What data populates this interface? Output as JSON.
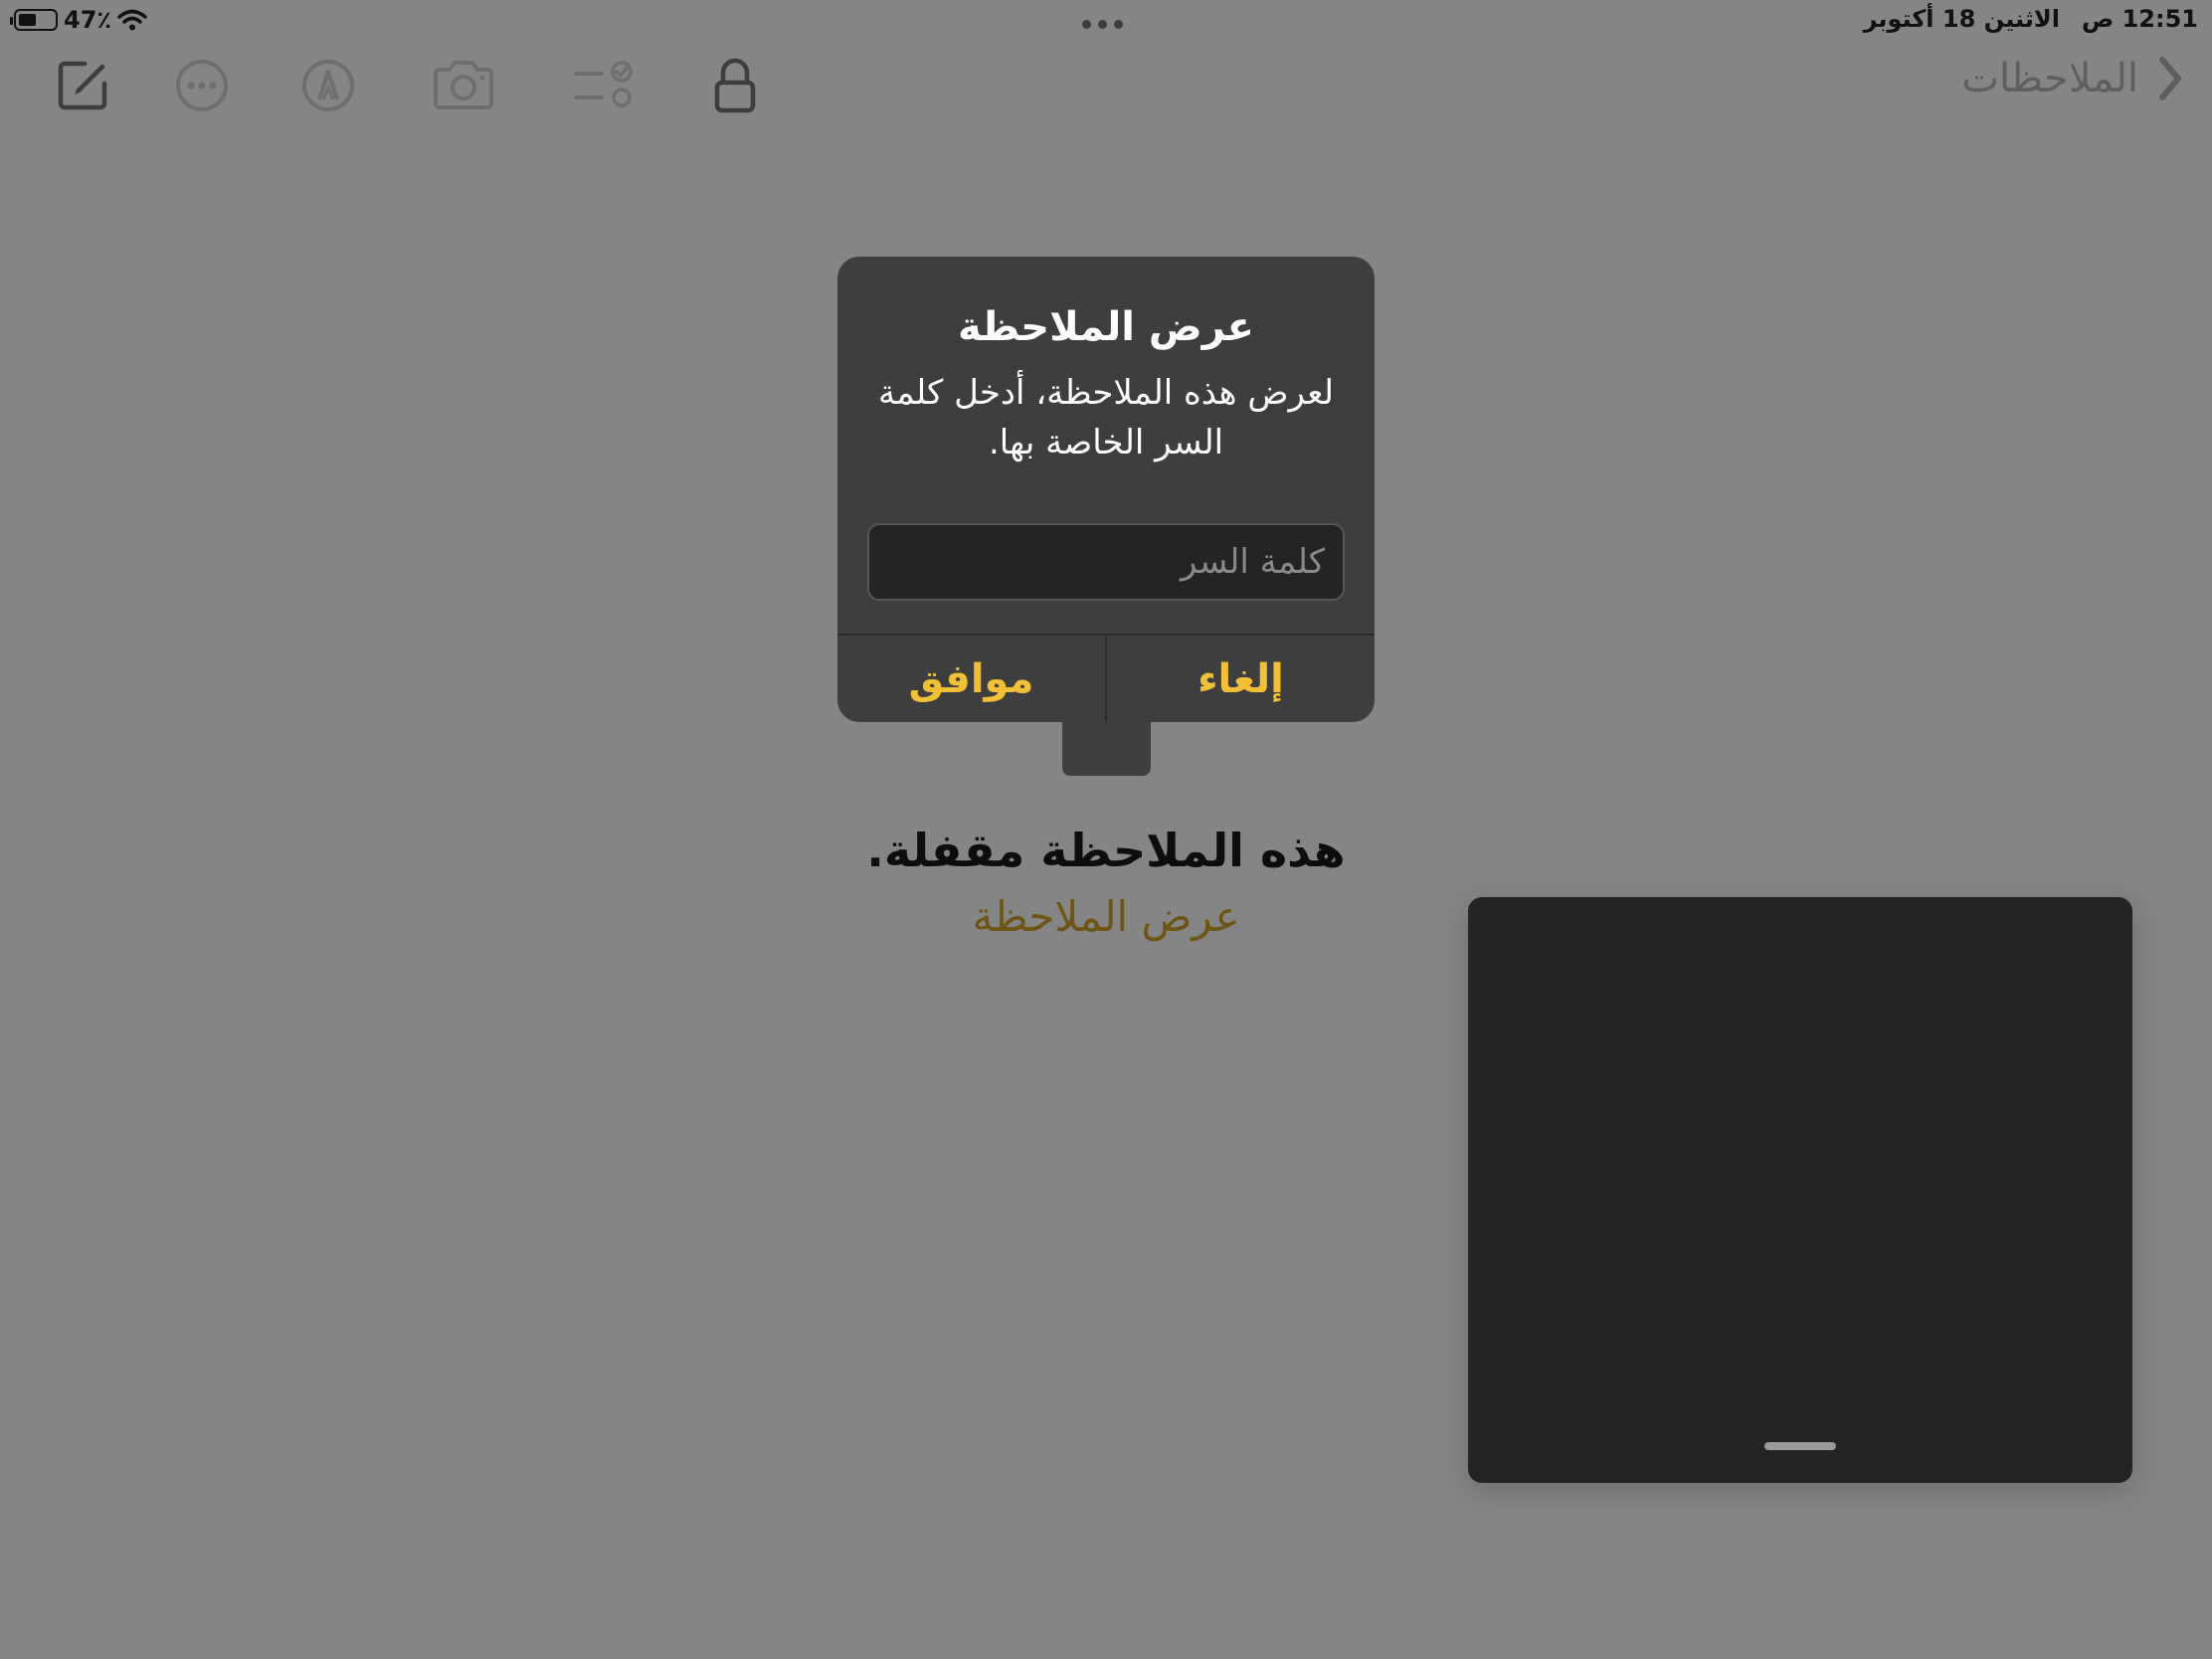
{
  "status_bar": {
    "battery_percent": "47٪",
    "battery_level": 0.47,
    "time": "12:51 ص",
    "date": "الاثنين 18 أكتوبر"
  },
  "toolbar": {
    "icons": [
      "compose-icon",
      "more-icon",
      "markup-icon",
      "camera-icon",
      "checklist-icon",
      "lock-icon"
    ],
    "back_label": "الملاحظات"
  },
  "dialog": {
    "title": "عرض الملاحظة",
    "message": "لعرض هذه الملاحظة، أدخل كلمة السر الخاصة بها.",
    "password_placeholder": "كلمة السر",
    "password_value": "",
    "ok_label": "موافق",
    "cancel_label": "إلغاء",
    "accent_color": "#f2c037"
  },
  "note": {
    "locked_title": "هذه الملاحظة مقفلة.",
    "view_link": "عرض الملاحظة"
  }
}
